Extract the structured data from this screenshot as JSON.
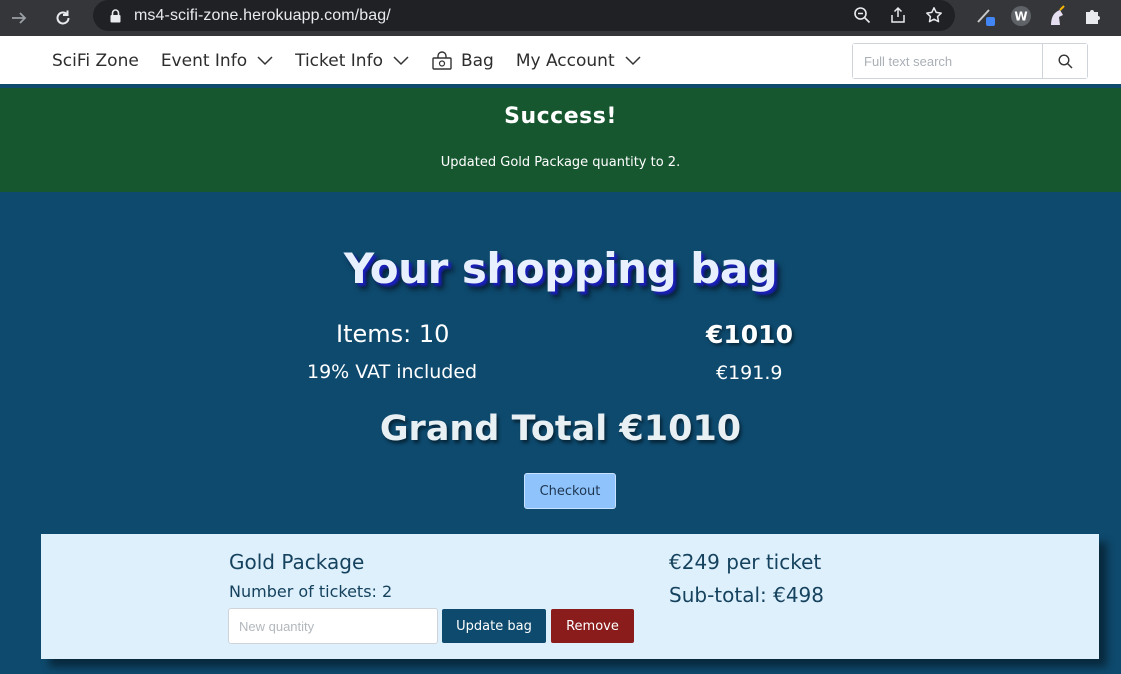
{
  "browser": {
    "url": "ms4-scifi-zone.herokuapp.com/bag/",
    "icons": [
      "forward-icon",
      "reload-icon",
      "lock-icon",
      "zoom-icon",
      "share-icon",
      "star-icon",
      "extension-pen-icon",
      "extension-w-icon",
      "extension-unicorn-icon",
      "puzzle-icon"
    ]
  },
  "header": {
    "brand": "SciFi Zone",
    "nav": {
      "event_info": "Event Info",
      "ticket_info": "Ticket Info",
      "bag": "Bag",
      "my_account": "My Account"
    },
    "search_placeholder": "Full text search"
  },
  "alert": {
    "title": "Success!",
    "message": "Updated Gold Package quantity to 2."
  },
  "bag": {
    "title": "Your shopping bag",
    "items_label": "Items: 10",
    "items_total": "€1010",
    "vat_label": "19% VAT included",
    "vat_value": "€191.9",
    "grand_total": "Grand Total €1010",
    "checkout_label": "Checkout"
  },
  "line_item": {
    "name": "Gold Package",
    "tickets": "Number of tickets: 2",
    "quantity_placeholder": "New quantity",
    "update_label": "Update bag",
    "remove_label": "Remove",
    "price": "€249 per ticket",
    "subtotal": "Sub-total: €498"
  },
  "colors": {
    "page_bg": "#0e4a6e",
    "alert_bg": "#175730",
    "card_bg": "#def0fb",
    "checkout_bg": "#8ec3fc",
    "remove_bg": "#8a1c1c"
  }
}
